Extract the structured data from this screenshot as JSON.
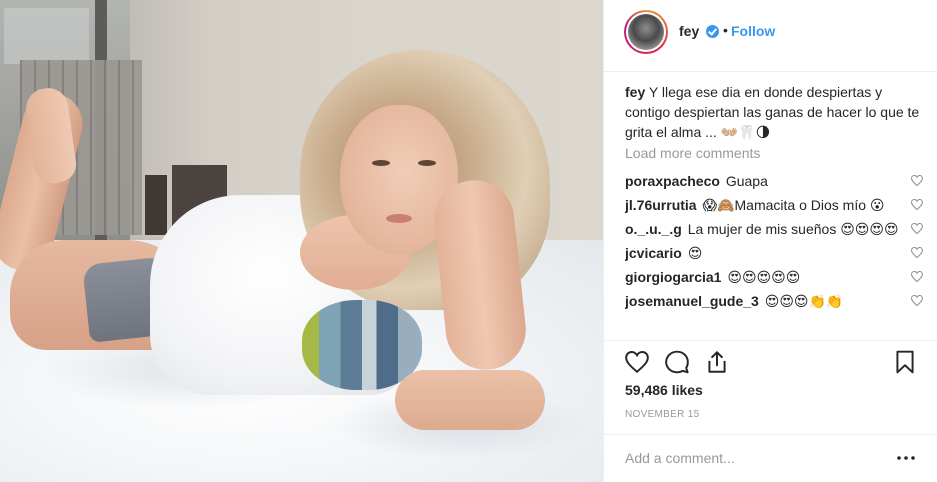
{
  "post": {
    "image_alt": "photo",
    "author": {
      "username": "fey",
      "verified": true,
      "separator": "•",
      "follow_label": "Follow"
    },
    "caption": {
      "username": "fey",
      "text": "Y llega ese dia en donde despiertas y contigo despiertan las ganas de hacer lo que te grita el alma ... 👐🏼🦷🌗"
    },
    "load_more_label": "Load more comments",
    "comments": [
      {
        "username": "poraxpacheco",
        "text": "Guapa"
      },
      {
        "username": "jl.76urrutia",
        "text": "😱🙈Mamacita o Dios mío 😮"
      },
      {
        "username": "o._.u._.g",
        "text": "La mujer de mis sueños 😍😍😍😍"
      },
      {
        "username": "jcvicario",
        "text": "😍"
      },
      {
        "username": "giorgiogarcia1",
        "text": "😍😍😍😍😍"
      },
      {
        "username": "josemanuel_gude_3",
        "text": "😍😍😍👏👏"
      }
    ],
    "likes_text": "59,486 likes",
    "date_text": "NOVEMBER 15",
    "add_comment_placeholder": "Add a comment...",
    "icons": {
      "like": "heart-icon",
      "comment": "comment-icon",
      "share": "share-icon",
      "save": "bookmark-icon",
      "more": "more-options-icon",
      "verified": "verified-badge-icon"
    },
    "colors": {
      "link_blue": "#3897f0",
      "muted_text": "#999999",
      "primary_text": "#262626",
      "border": "#efefef"
    }
  }
}
